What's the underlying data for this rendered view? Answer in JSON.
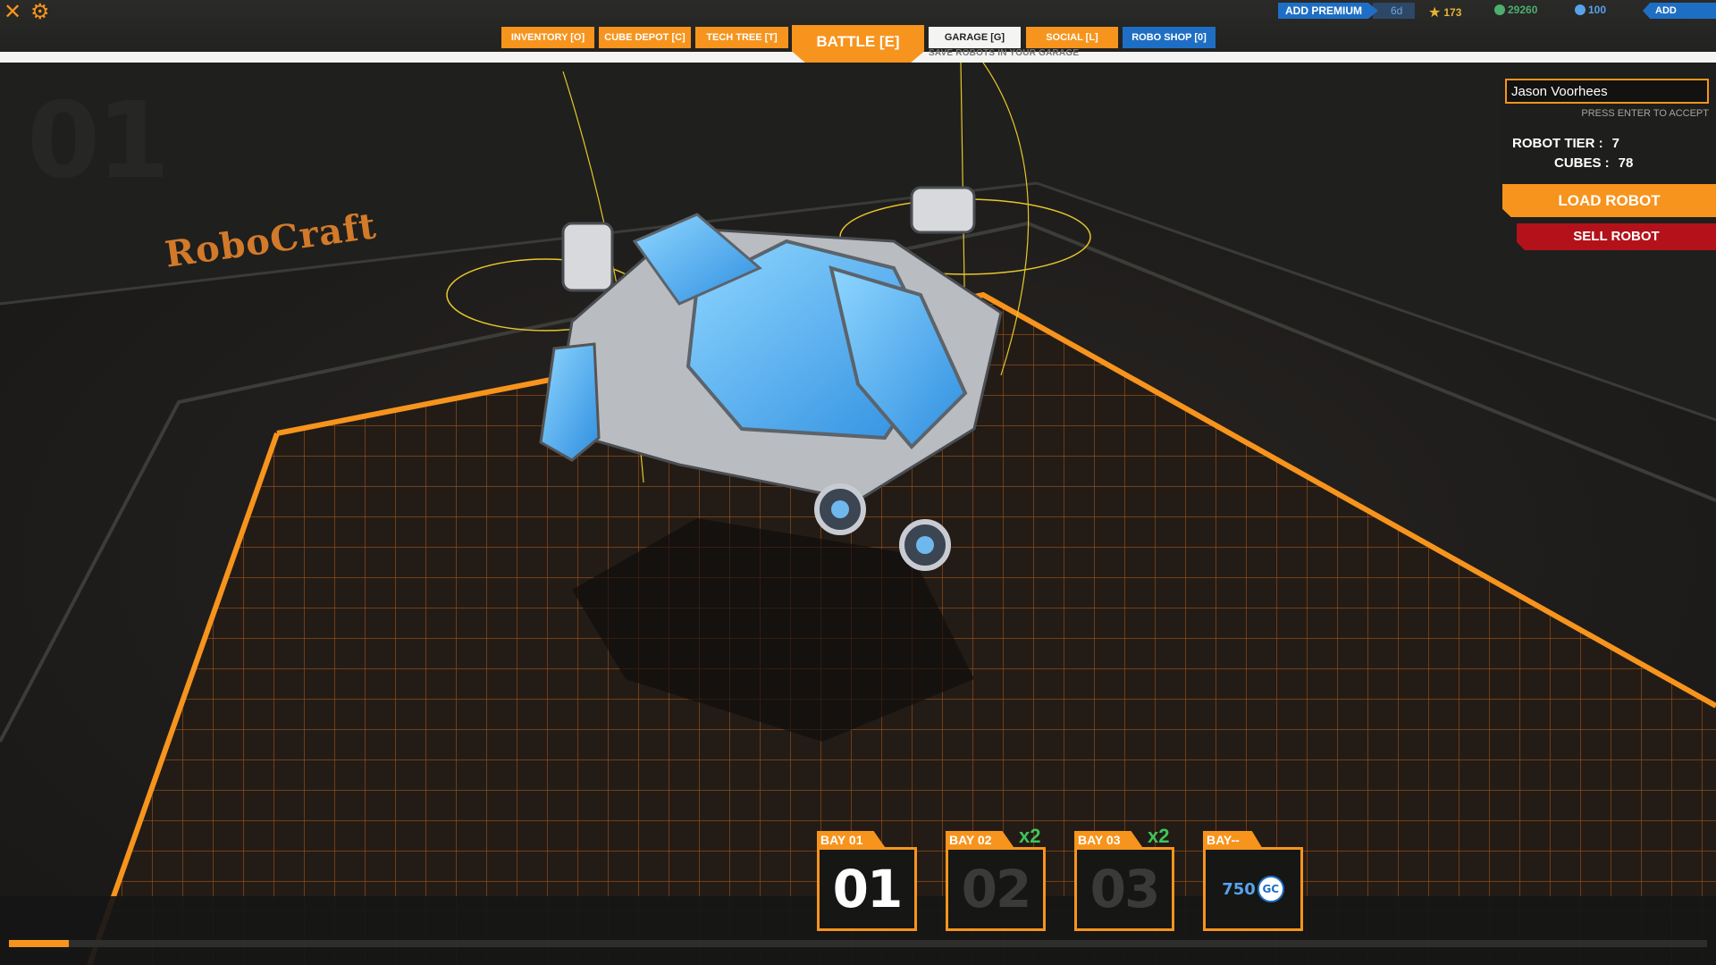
{
  "top_bar": {
    "add_premium_label": "ADD PREMIUM",
    "premium_days": "6d",
    "tech_points": "173",
    "robits": "29260",
    "galaxy_coins": "100",
    "galaxy_coins_symbol": "GC",
    "add_funds_label": "ADD FUNDS"
  },
  "nav": {
    "tabs": [
      {
        "label": "INVENTORY [O]"
      },
      {
        "label": "CUBE DEPOT [C]"
      },
      {
        "label": "TECH TREE [T]"
      },
      {
        "label": "BATTLE [E]"
      },
      {
        "label": "GARAGE [G]"
      },
      {
        "label": "SOCIAL [L]"
      },
      {
        "label": "ROBO SHOP [0]"
      }
    ],
    "active": "GARAGE [G]",
    "garage_hint": "SAVE ROBOTS IN YOUR GARAGE"
  },
  "scene": {
    "bay_number": "01",
    "logo_text": "RoboCraft"
  },
  "robot_panel": {
    "name_value": "Jason Voorhees",
    "name_hint": "PRESS ENTER TO ACCEPT",
    "tier_label": "ROBOT TIER :",
    "tier_value": "7",
    "cubes_label": "CUBES :",
    "cubes_value": "78",
    "load_label": "LOAD ROBOT",
    "sell_label": "SELL ROBOT"
  },
  "bays": [
    {
      "label": "BAY 01",
      "number": "01",
      "multiplier": "",
      "active": true
    },
    {
      "label": "BAY 02",
      "number": "02",
      "multiplier": "x2",
      "active": false
    },
    {
      "label": "BAY 03",
      "number": "03",
      "multiplier": "x2",
      "active": false
    },
    {
      "label": "BAY--",
      "price": "750",
      "currency": "GC",
      "active": false
    }
  ],
  "progress": {
    "fraction": 0.035
  },
  "colors": {
    "accent_orange": "#f7941d",
    "premium_blue": "#1e6fc4",
    "sell_red": "#b3121a",
    "multiplier_green": "#3fc45a"
  },
  "icons": {
    "close": "close-icon",
    "settings": "gear-icon",
    "tech_points": "star-icon",
    "robits": "robit-icon",
    "galaxy_coins": "gc-coin-icon"
  }
}
